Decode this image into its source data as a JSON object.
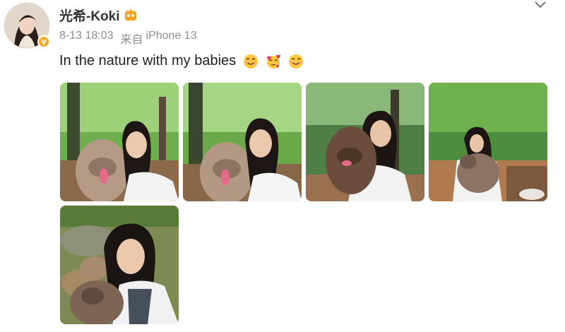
{
  "post": {
    "username": "光希-Koki",
    "date": "8-13 18:03",
    "source_prefix": "来自",
    "device": "iPhone 13",
    "text": "In the nature with my babies"
  },
  "icons": {
    "vip": "vip-badge-icon",
    "verified": "verified-badge-icon",
    "more": "chevron-down-icon",
    "emojis": [
      "smiling-emoji",
      "hearts-emoji",
      "smiling-emoji"
    ]
  },
  "photos": [
    {
      "name": "photo-1"
    },
    {
      "name": "photo-2"
    },
    {
      "name": "photo-3"
    },
    {
      "name": "photo-4"
    },
    {
      "name": "photo-5"
    }
  ],
  "colors": {
    "verified": "#f5a623",
    "meta_text": "#8f8f8f",
    "name_text": "#333333"
  }
}
